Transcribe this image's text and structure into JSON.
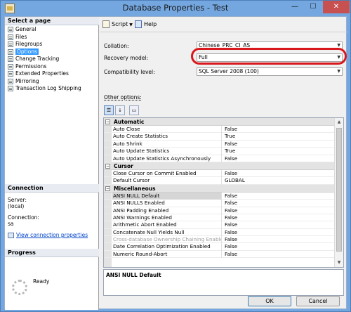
{
  "window": {
    "title": "Database Properties - Test",
    "close_glyph": "✕",
    "min_glyph": "—",
    "max_glyph": "☐"
  },
  "left": {
    "select_page_header": "Select a page",
    "pages": [
      {
        "label": "General",
        "icon": "page-icon"
      },
      {
        "label": "Files",
        "icon": "page-icon"
      },
      {
        "label": "Filegroups",
        "icon": "page-icon"
      },
      {
        "label": "Options",
        "icon": "page-icon",
        "selected": true
      },
      {
        "label": "Change Tracking",
        "icon": "page-icon"
      },
      {
        "label": "Permissions",
        "icon": "page-icon"
      },
      {
        "label": "Extended Properties",
        "icon": "page-icon"
      },
      {
        "label": "Mirroring",
        "icon": "page-icon"
      },
      {
        "label": "Transaction Log Shipping",
        "icon": "page-icon"
      }
    ],
    "connection_header": "Connection",
    "server_label": "Server:",
    "server_value": "(local)",
    "connection_label": "Connection:",
    "connection_value": "sa",
    "view_connection_link": "View connection properties",
    "progress_header": "Progress",
    "progress_status": "Ready"
  },
  "toolbar": {
    "script_label": "Script",
    "help_label": "Help"
  },
  "form": {
    "collation_label": "Collation:",
    "collation_value": "Chinese_PRC_CI_AS",
    "recovery_label": "Recovery model:",
    "recovery_value": "Full",
    "compat_label": "Compatibility level:",
    "compat_value": "SQL Server 2008 (100)",
    "other_options_label": "Other options:"
  },
  "grid": {
    "categories": [
      {
        "name": "Automatic",
        "rows": [
          {
            "name": "Auto Close",
            "value": "False"
          },
          {
            "name": "Auto Create Statistics",
            "value": "True"
          },
          {
            "name": "Auto Shrink",
            "value": "False"
          },
          {
            "name": "Auto Update Statistics",
            "value": "True"
          },
          {
            "name": "Auto Update Statistics Asynchronously",
            "value": "False"
          }
        ]
      },
      {
        "name": "Cursor",
        "rows": [
          {
            "name": "Close Cursor on Commit Enabled",
            "value": "False"
          },
          {
            "name": "Default Cursor",
            "value": "GLOBAL"
          }
        ]
      },
      {
        "name": "Miscellaneous",
        "rows": [
          {
            "name": "ANSI NULL Default",
            "value": "False",
            "selected": true
          },
          {
            "name": "ANSI NULLS Enabled",
            "value": "False"
          },
          {
            "name": "ANSI Padding Enabled",
            "value": "False"
          },
          {
            "name": "ANSI Warnings Enabled",
            "value": "False"
          },
          {
            "name": "Arithmetic Abort Enabled",
            "value": "False"
          },
          {
            "name": "Concatenate Null Yields Null",
            "value": "False"
          },
          {
            "name": "Cross-database Ownership Chaining Enabled",
            "value": "False",
            "dim": true
          },
          {
            "name": "Date Correlation Optimization Enabled",
            "value": "False"
          },
          {
            "name": "Numeric Round-Abort",
            "value": "False"
          }
        ]
      }
    ],
    "description": "ANSI NULL Default"
  },
  "buttons": {
    "ok": "OK",
    "cancel": "Cancel"
  }
}
